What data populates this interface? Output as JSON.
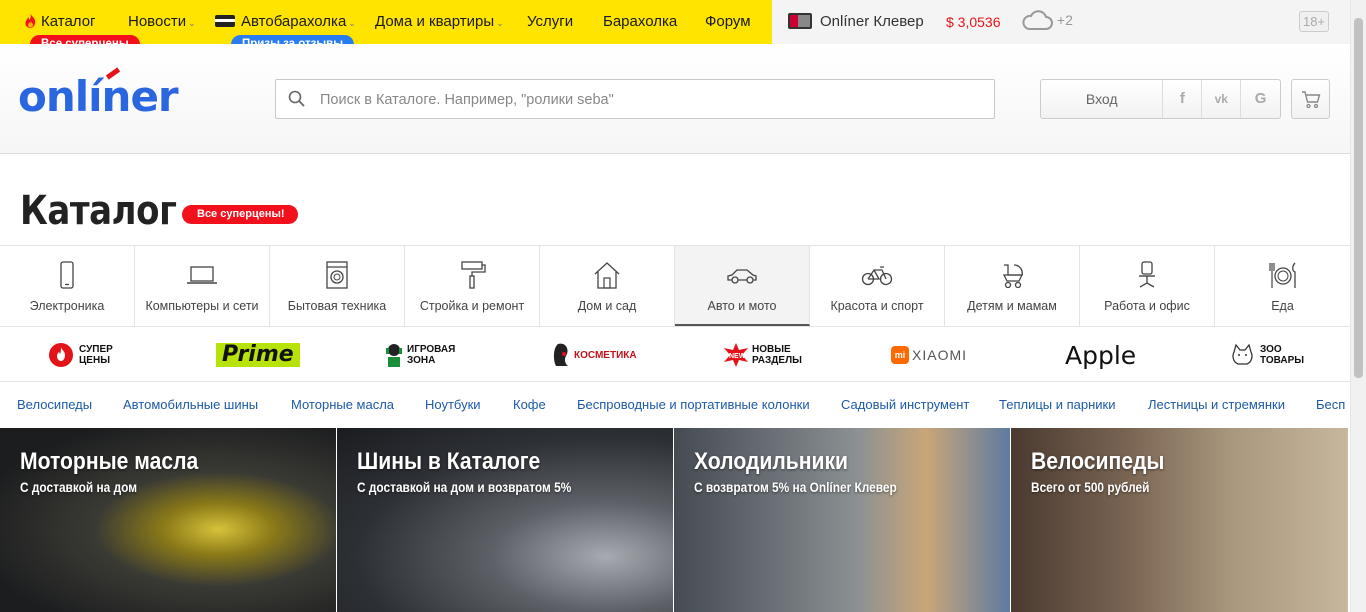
{
  "topbar": {
    "nav": [
      {
        "label": "Каталог",
        "icon": "fire-icon"
      },
      {
        "label": "Новости",
        "dropdown": true
      },
      {
        "label": "Автобарахолка",
        "dropdown": true,
        "icon": "card-icon"
      },
      {
        "label": "Дома и квартиры",
        "dropdown": true
      },
      {
        "label": "Услуги"
      },
      {
        "label": "Барахолка"
      },
      {
        "label": "Форум"
      }
    ],
    "badge_catalog": "Все суперцены",
    "badge_auto": "Призы за отзывы",
    "klever": "Onlíner Клевер",
    "rate": "$ 3,0536",
    "weather": "+2",
    "age": "18+"
  },
  "header": {
    "logo": "onlíner",
    "search_placeholder": "Поиск в Каталоге. Например, \"ролики seba\"",
    "login": "Вход",
    "social": [
      "f",
      "vk",
      "G"
    ]
  },
  "page": {
    "title": "Каталог",
    "title_badge": "Все суперцены!"
  },
  "categories": [
    {
      "label": "Электроника",
      "icon": "smartphone-icon"
    },
    {
      "label": "Компьютеры и сети",
      "icon": "laptop-icon"
    },
    {
      "label": "Бытовая техника",
      "icon": "washing-machine-icon"
    },
    {
      "label": "Стройка и ремонт",
      "icon": "paint-roller-icon"
    },
    {
      "label": "Дом и сад",
      "icon": "house-icon"
    },
    {
      "label": "Авто и мото",
      "icon": "car-icon",
      "active": true
    },
    {
      "label": "Красота и спорт",
      "icon": "bicycle-icon"
    },
    {
      "label": "Детям и мамам",
      "icon": "stroller-icon"
    },
    {
      "label": "Работа и офис",
      "icon": "office-chair-icon"
    },
    {
      "label": "Еда",
      "icon": "plate-icon"
    }
  ],
  "promos": {
    "super_prices": [
      "СУПЕР",
      "ЦЕНЫ"
    ],
    "prime": "Prime",
    "game_zone": [
      "ИГРОВАЯ",
      "ЗОНА"
    ],
    "cosmetics": "КОСМЕТИКА",
    "new_sections": [
      "НОВЫЕ",
      "РАЗДЕЛЫ"
    ],
    "xiaomi": "XIAOMI",
    "apple": "Apple",
    "zoo": [
      "ЗОО",
      "ТОВАРЫ"
    ]
  },
  "quick_links": [
    "Велосипеды",
    "Автомобильные шины",
    "Моторные масла",
    "Ноутбуки",
    "Кофе",
    "Беспроводные и портативные колонки",
    "Садовый инструмент",
    "Теплицы и парники",
    "Лестницы и стремянки",
    "Бесп"
  ],
  "banners": [
    {
      "title": "Моторные масла",
      "subtitle": "С доставкой на дом"
    },
    {
      "title": "Шины в Каталоге",
      "subtitle": "С доставкой на дом и возвратом 5%"
    },
    {
      "title": "Холодильники",
      "subtitle": "С возвратом 5% на Onlíner Клевер"
    },
    {
      "title": "Велосипеды",
      "subtitle": "Всего от 500 рублей"
    }
  ],
  "colors": {
    "yellow": "#ffe400",
    "brand_blue": "#2a66df",
    "red": "#f1101c",
    "link_blue": "#1d5aa8"
  }
}
